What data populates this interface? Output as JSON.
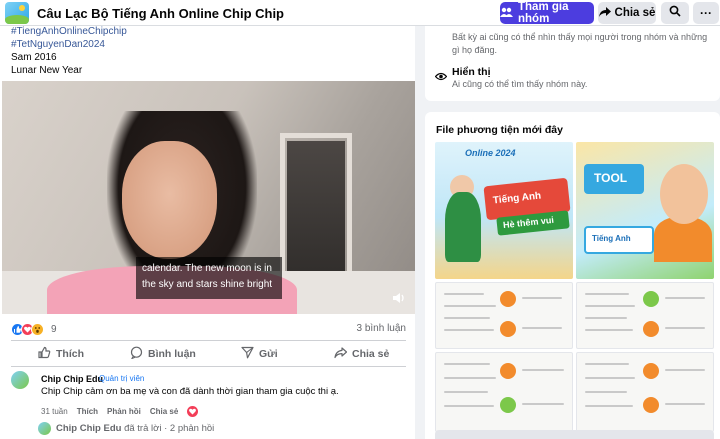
{
  "header": {
    "group_name": "Câu Lạc Bộ Tiếng Anh Online Chip Chip",
    "join_label": "Tham gia nhóm",
    "share_label": "Chia sẻ",
    "more_label": "···",
    "accent_color": "#4c3ddf"
  },
  "post": {
    "hashtag_partial": "#TiengAnhOnlineChipchip",
    "hashtag": "#TetNguyenDan2024",
    "line1": "Sam 2016",
    "line2": "Lunar New Year",
    "caption_line1": "calendar. The new moon is in",
    "caption_line2": "the sky and stars shine bright",
    "reaction_count": "9",
    "comment_count": "3 bình luận",
    "actions": {
      "like": "Thích",
      "comment": "Bình luận",
      "send": "Gửi",
      "share": "Chia sẻ"
    }
  },
  "comment": {
    "author": "Chip Chip Edu",
    "role": "Quản trị viên",
    "text": "Chip Chip cảm ơn ba mẹ và con đã dành thời gian tham gia cuộc thi ạ.",
    "time": "31 tuần",
    "like": "Thích",
    "reply": "Phản hồi",
    "share": "Chia sẻ",
    "replies_author": "Chip Chip Edu",
    "replies_text": "đã trả lời · 2 phản hồi"
  },
  "about": {
    "privacy_desc_line1": "Bất kỳ ai cũng có thể nhìn thấy mọi người trong nhóm và những",
    "privacy_desc_line2": "gì họ đăng.",
    "visible_title": "Hiển thị",
    "visible_desc": "Ai cũng có thể tìm thấy nhóm này."
  },
  "media": {
    "title": "File phương tiện mới đây",
    "t1_heading": "Online 2024",
    "t1_banner": "Tiếng Anh",
    "t1_sub": "Hè thêm vui",
    "t2_tag": "TOOL",
    "t2_sub": "Tiếng Anh"
  }
}
